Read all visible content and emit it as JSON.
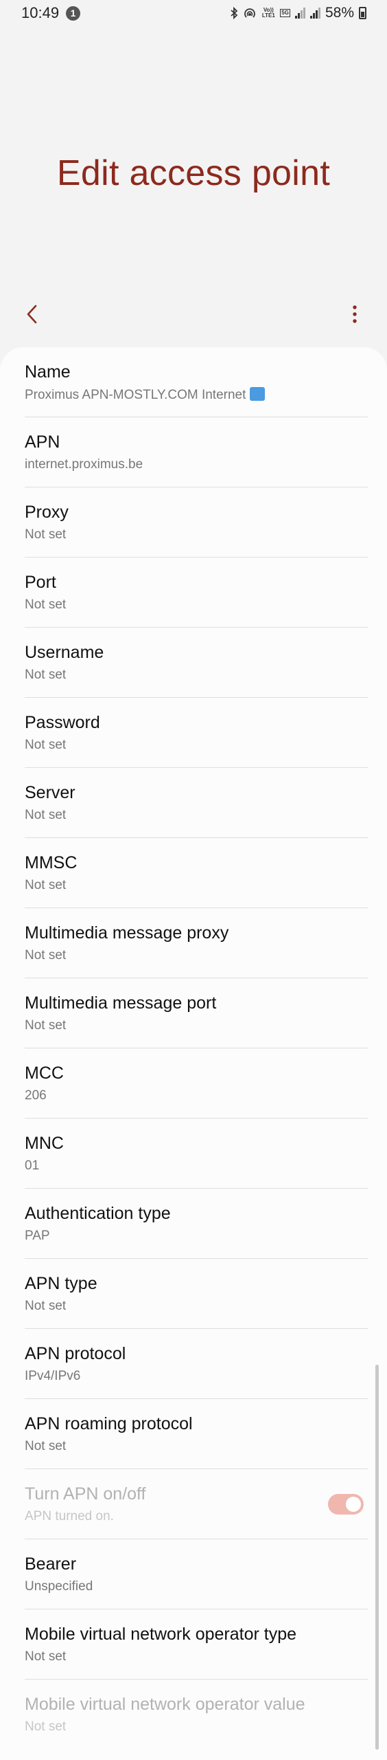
{
  "status_bar": {
    "time": "10:49",
    "notification_count": "1",
    "volte_label": "Vo)) LTE1",
    "fiveg_label": "5G",
    "battery": "58%"
  },
  "page": {
    "title": "Edit access point"
  },
  "toolbar": {
    "back_icon": "chevron-left-icon",
    "more_icon": "more-vert-icon"
  },
  "colors": {
    "accent": "#8c2a1d",
    "toggle_track": "#f0b7ae",
    "background": "#f3f3f3",
    "card": "#fcfcfd"
  },
  "settings": [
    {
      "title": "Name",
      "value": "Proximus APN-MOSTLY.COM Internet"
    },
    {
      "title": "APN",
      "value": "internet.proximus.be"
    },
    {
      "title": "Proxy",
      "value": "Not set"
    },
    {
      "title": "Port",
      "value": "Not set"
    },
    {
      "title": "Username",
      "value": "Not set"
    },
    {
      "title": "Password",
      "value": "Not set"
    },
    {
      "title": "Server",
      "value": "Not set"
    },
    {
      "title": "MMSC",
      "value": "Not set"
    },
    {
      "title": "Multimedia message proxy",
      "value": "Not set"
    },
    {
      "title": "Multimedia message port",
      "value": "Not set"
    },
    {
      "title": "MCC",
      "value": "206"
    },
    {
      "title": "MNC",
      "value": "01"
    },
    {
      "title": "Authentication type",
      "value": "PAP"
    },
    {
      "title": "APN type",
      "value": "Not set"
    },
    {
      "title": "APN protocol",
      "value": "IPv4/IPv6"
    },
    {
      "title": "APN roaming protocol",
      "value": "Not set"
    },
    {
      "title": "Turn APN on/off",
      "value": "APN turned on.",
      "toggle_on": true,
      "enabled": false
    },
    {
      "title": "Bearer",
      "value": "Unspecified"
    },
    {
      "title": "Mobile virtual network operator type",
      "value": "Not set"
    },
    {
      "title": "Mobile virtual network operator value",
      "value": "Not set",
      "enabled": false
    }
  ]
}
